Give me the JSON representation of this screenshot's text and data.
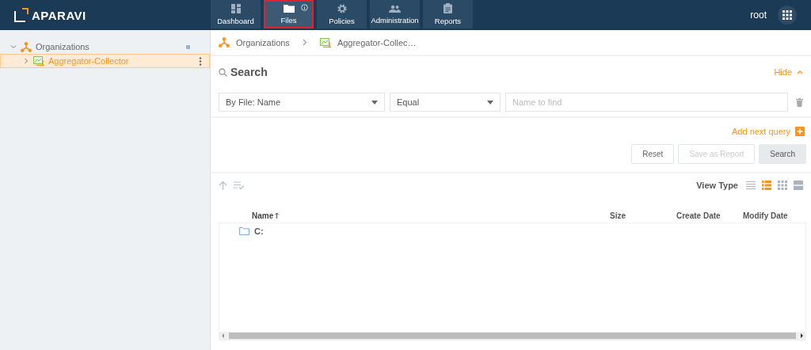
{
  "logo": {
    "text": "APARAVI"
  },
  "nav": [
    {
      "label": "Dashboard",
      "kind": "dashboard",
      "selected": false,
      "info": false
    },
    {
      "label": "Files",
      "kind": "folder",
      "selected": true,
      "info": true
    },
    {
      "label": "Policies",
      "kind": "gear",
      "selected": false,
      "info": false
    },
    {
      "label": "Administration",
      "kind": "people",
      "selected": false,
      "info": false
    },
    {
      "label": "Reports",
      "kind": "clipboard",
      "selected": false,
      "info": false
    }
  ],
  "user": "root",
  "tree": [
    {
      "label": "Organizations",
      "kind": "org",
      "expanded": true,
      "selected": false,
      "children": [
        {
          "label": "Aggregator-Collector",
          "kind": "collector",
          "expanded": false,
          "selected": true
        }
      ]
    }
  ],
  "breadcrumb": [
    {
      "label": "Organizations",
      "kind": "org"
    },
    {
      "label": "Aggregator-Collec…",
      "kind": "collector"
    }
  ],
  "search": {
    "title": "Search",
    "toggle": "Hide",
    "query": [
      {
        "field": "By File: Name",
        "operator": "Equal",
        "placeholder": "Name to find"
      }
    ],
    "add_query": "Add next query",
    "buttons": [
      {
        "label": "Reset",
        "disabled": false,
        "primary": false
      },
      {
        "label": "Save as Report",
        "disabled": true,
        "primary": false
      },
      {
        "label": "Search",
        "disabled": false,
        "primary": true
      }
    ]
  },
  "view_type": {
    "label": "View Type",
    "options": [
      {
        "kind": "list",
        "selected": false
      },
      {
        "kind": "details",
        "selected": true
      },
      {
        "kind": "grid",
        "selected": false
      },
      {
        "kind": "tiles",
        "selected": false
      }
    ]
  },
  "table": {
    "columns": [
      {
        "label": "Name",
        "sorted": true
      },
      {
        "label": "Size",
        "sorted": false
      },
      {
        "label": "Create Date",
        "sorted": false
      },
      {
        "label": "Modify Date",
        "sorted": false
      }
    ],
    "rows": [
      {
        "name": "C:",
        "kind": "folder"
      }
    ]
  }
}
